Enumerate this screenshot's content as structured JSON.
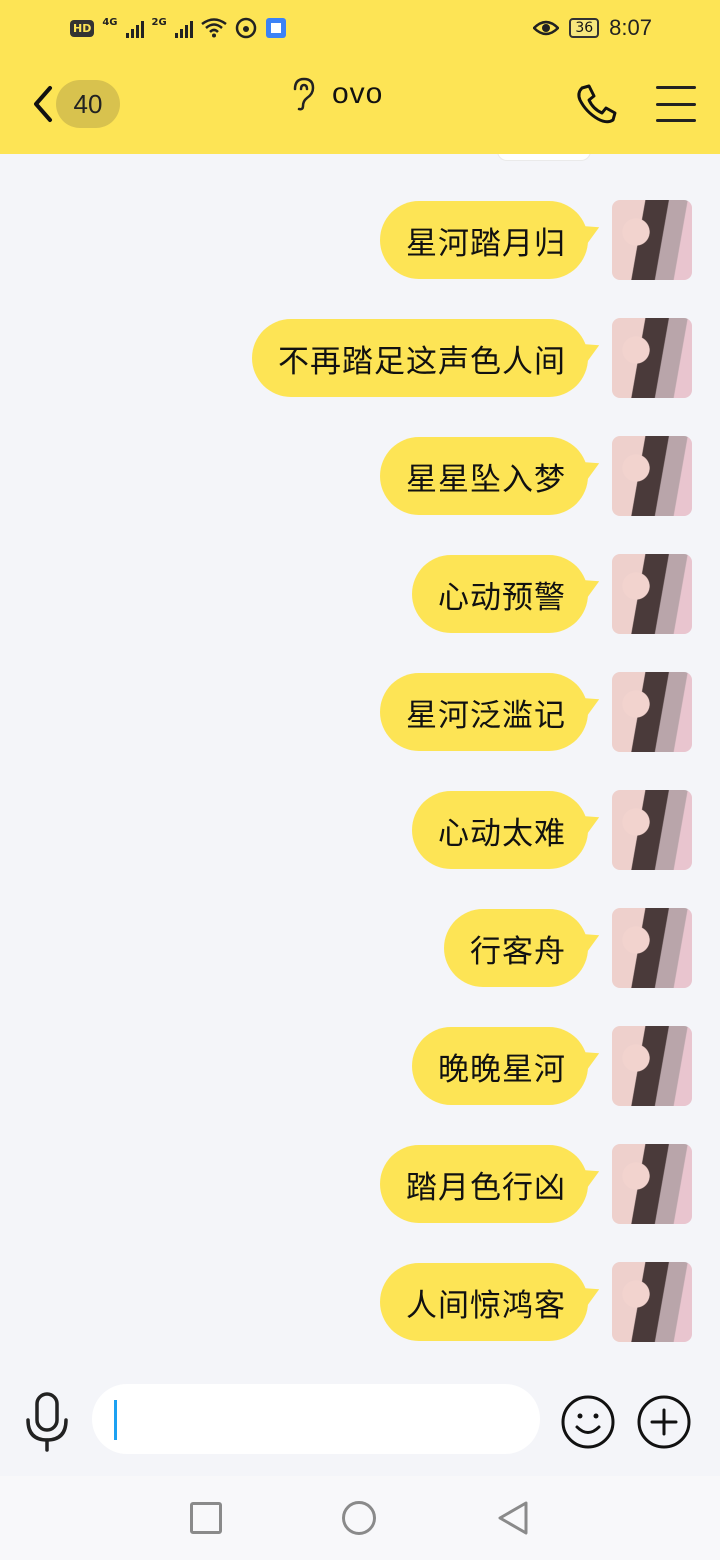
{
  "status_bar": {
    "hd_label": "HD",
    "network_1": "4G",
    "network_2": "2G",
    "battery": "36",
    "time": "8:07"
  },
  "header": {
    "unread_count": "40",
    "title": "ovo"
  },
  "messages": [
    {
      "text": "星河踏月归"
    },
    {
      "text": "不再踏足这声色人间"
    },
    {
      "text": "星星坠入梦"
    },
    {
      "text": "心动预警"
    },
    {
      "text": "星河泛滥记"
    },
    {
      "text": "心动太难"
    },
    {
      "text": "行客舟"
    },
    {
      "text": "晚晚星河"
    },
    {
      "text": "踏月色行凶"
    },
    {
      "text": "人间惊鸿客"
    }
  ],
  "input": {
    "value": ""
  },
  "colors": {
    "accent": "#fde455",
    "background": "#f4f5f9",
    "caret": "#1da1f2"
  },
  "icons": [
    "back-icon",
    "ear-icon",
    "phone-icon",
    "menu-icon",
    "mic-icon",
    "emoji-icon",
    "plus-icon",
    "nav-recents-icon",
    "nav-home-icon",
    "nav-back-icon"
  ]
}
